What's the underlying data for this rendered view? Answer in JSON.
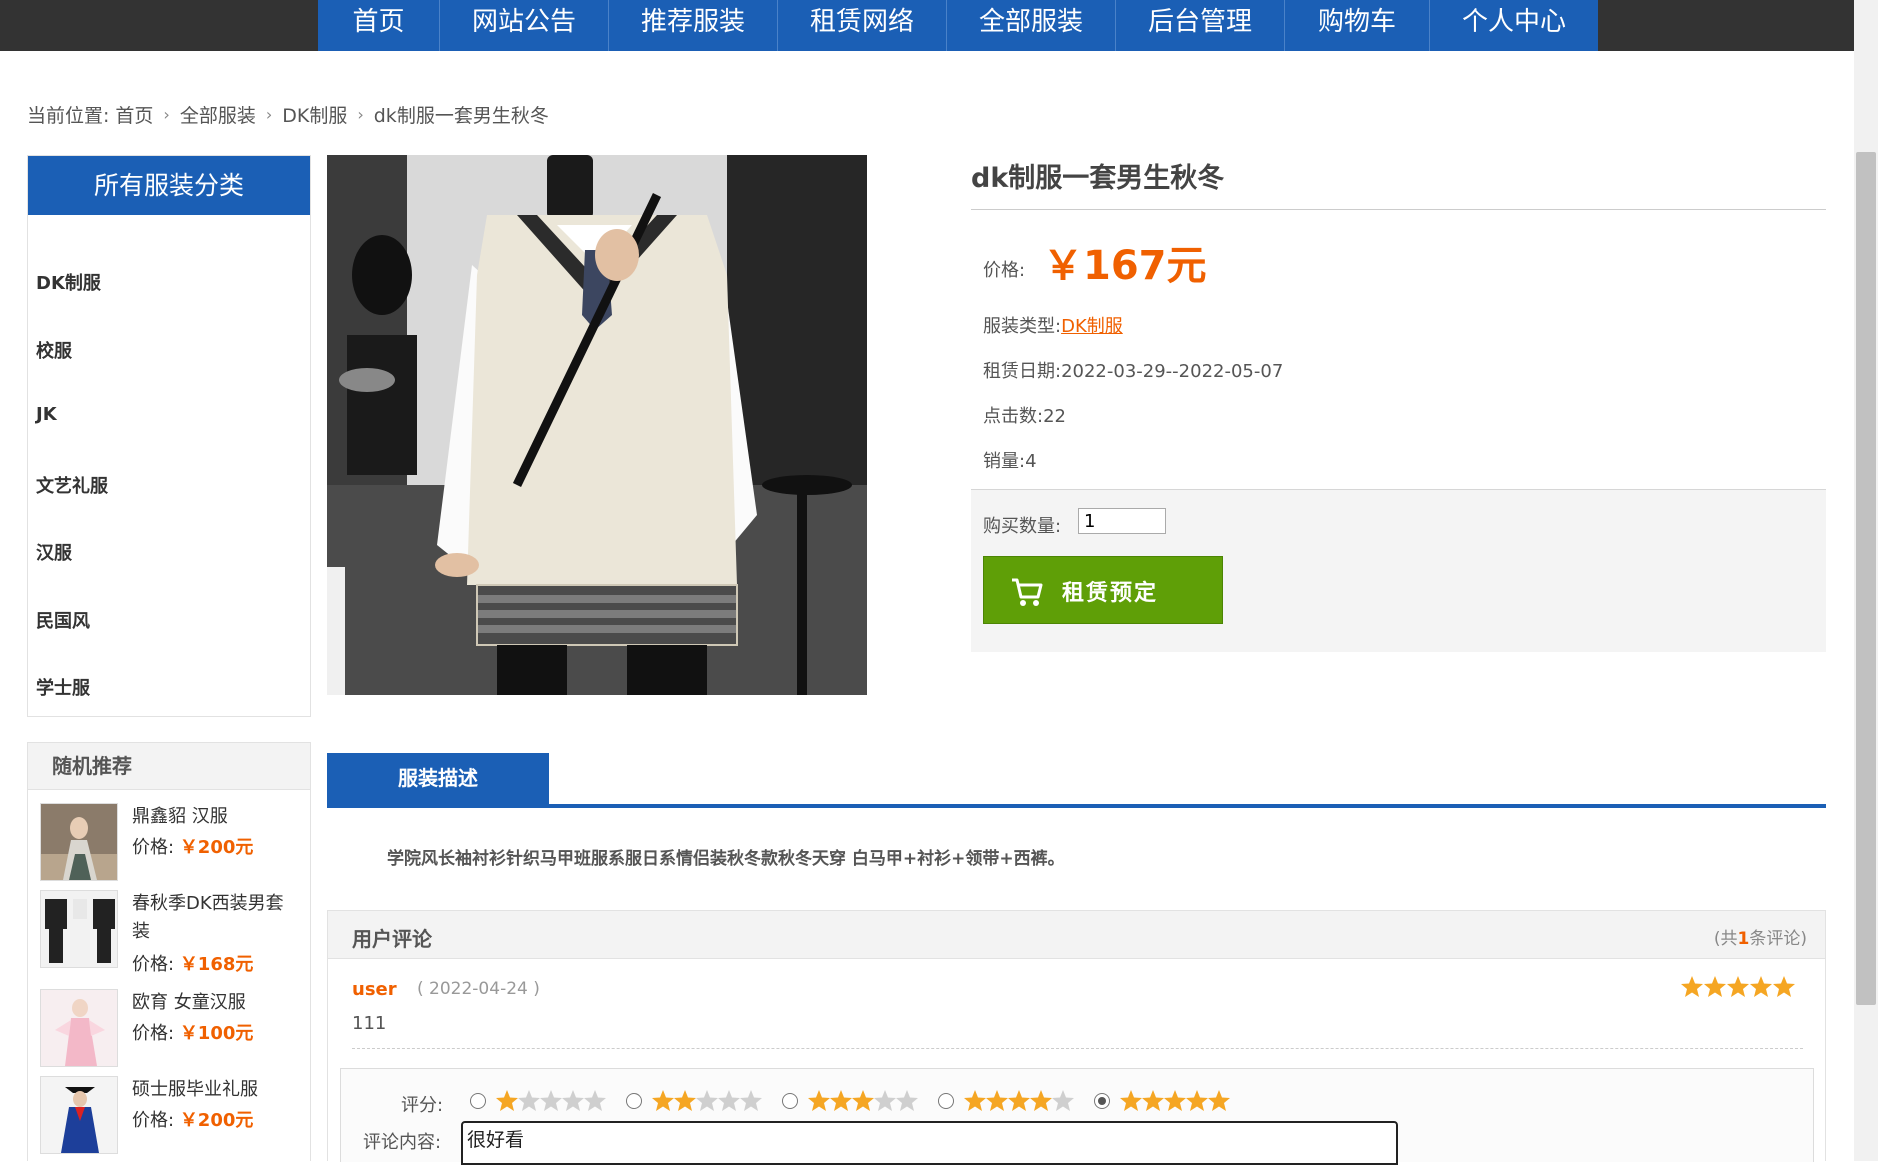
{
  "nav": {
    "items": [
      "首页",
      "网站公告",
      "推荐服装",
      "租赁网络",
      "全部服装",
      "后台管理",
      "购物车",
      "个人中心"
    ]
  },
  "breadcrumb": {
    "prefix": "当前位置:",
    "items": [
      "首页",
      "全部服装",
      "DK制服",
      "dk制服一套男生秋冬"
    ]
  },
  "sidebar": {
    "title": "所有服装分类",
    "categories": [
      "DK制服",
      "校服",
      "JK",
      "文艺礼服",
      "汉服",
      "民国风",
      "学士服"
    ]
  },
  "recommend": {
    "title": "随机推荐",
    "price_label": "价格:",
    "items": [
      {
        "name": "鼎鑫貂 汉服",
        "price": "￥200元"
      },
      {
        "name": "春秋季DK西装男套装",
        "price": "￥168元"
      },
      {
        "name": "欧育 女童汉服",
        "price": "￥100元"
      },
      {
        "name": "硕士服毕业礼服",
        "price": "￥200元"
      }
    ]
  },
  "product": {
    "title": "dk制服一套男生秋冬",
    "price_label": "价格:",
    "price": "￥167元",
    "type_label": "服装类型:",
    "type": "DK制服",
    "date_label": "租赁日期:",
    "date": "2022-03-29--2022-05-07",
    "clicks_label": "点击数:",
    "clicks": "22",
    "sales_label": "销量:",
    "sales": "4",
    "qty_label": "购买数量:",
    "qty": "1",
    "rent_button": "租赁预定"
  },
  "description": {
    "tab": "服装描述",
    "text": "学院风长袖衬衫针织马甲班服系服日系情侣装秋冬款秋冬天穿 白马甲+衬衫+领带+西裤。"
  },
  "comments": {
    "title": "用户评论",
    "count_prefix": "(共",
    "count": "1",
    "count_suffix": "条评论)",
    "list": [
      {
        "user": "user",
        "date": "( 2022-04-24 )",
        "text": "111",
        "rating": 5
      }
    ],
    "form": {
      "score_label": "评分:",
      "selected_score": 5,
      "content_label": "评论内容:",
      "content_value": "很好看"
    }
  },
  "colors": {
    "nav_blue": "#1b5fb5",
    "accent_orange": "#f06000",
    "button_green": "#5f9f07",
    "star_orange": "#f5a623"
  }
}
